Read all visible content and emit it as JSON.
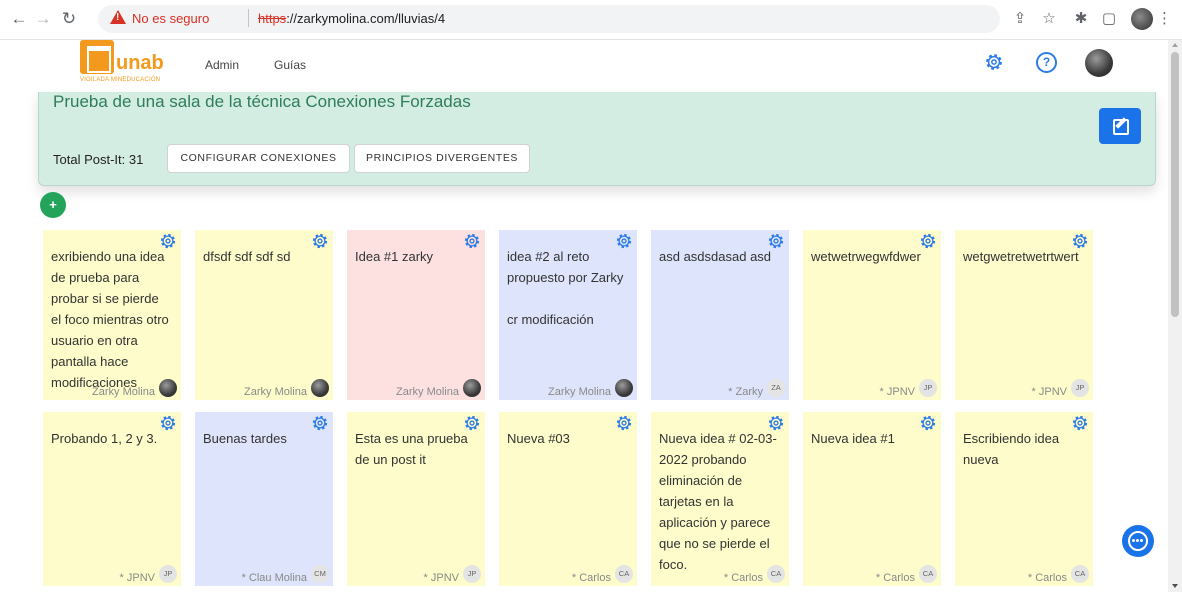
{
  "browser": {
    "insecure_label": "No es seguro",
    "url_scheme": "https",
    "url_rest": "://zarkymolina.com/lluvias/4"
  },
  "navbar": {
    "logo_text": "unab",
    "logo_subtitle": "VIGILADA MINEDUCACIÓN",
    "links": [
      "Admin",
      "Guías"
    ],
    "help_label": "?"
  },
  "room": {
    "title": "Prueba de una sala de la técnica Conexiones Forzadas",
    "total_label": "Total Post-It: 31",
    "buttons": [
      "CONFIGURAR CONEXIONES",
      "PRINCIPIOS DIVERGENTES"
    ]
  },
  "add_label": "+",
  "colors": {
    "yellow": "#fdfcca",
    "pink": "#fde0e0",
    "blue": "#dde4fb",
    "accent": "#1a73e8",
    "green": "#24a35a"
  },
  "posts": [
    {
      "text": "exribiendo una idea de prueba para probar si se pierde el foco mientras otro usuario en otra pantalla hace modificaciones",
      "author": "Zarky Molina",
      "initials": "",
      "color": "yellow"
    },
    {
      "text": "dfsdf sdf sdf sd",
      "author": "Zarky Molina",
      "initials": "",
      "color": "yellow"
    },
    {
      "text": "Idea #1 zarky",
      "author": "Zarky Molina",
      "initials": "",
      "color": "pink"
    },
    {
      "text": "idea #2 al reto propuesto por Zarky\n\ncr modificación",
      "author": "Zarky Molina",
      "initials": "",
      "color": "blue"
    },
    {
      "text": "asd asdsdasad asd",
      "author": "* Zarky",
      "initials": "ZA",
      "color": "blue"
    },
    {
      "text": "wetwetrwegwfdwer",
      "author": "* JPNV",
      "initials": "JP",
      "color": "yellow"
    },
    {
      "text": "wetgwetretwetrtwert",
      "author": "* JPNV",
      "initials": "JP",
      "color": "yellow"
    },
    {
      "text": "Probando 1, 2 y 3.",
      "author": "* JPNV",
      "initials": "JP",
      "color": "yellow"
    },
    {
      "text": "Buenas tardes",
      "author": "* Clau Molina",
      "initials": "CM",
      "color": "blue"
    },
    {
      "text": "Esta es una prueba de un post it",
      "author": "* JPNV",
      "initials": "JP",
      "color": "yellow"
    },
    {
      "text": "Nueva #03",
      "author": "* Carlos",
      "initials": "CA",
      "color": "yellow"
    },
    {
      "text": "Nueva idea # 02-03-2022 probando eliminación de tarjetas en la aplicación y parece que no se pierde el foco.",
      "author": "* Carlos",
      "initials": "CA",
      "color": "yellow"
    },
    {
      "text": "Nueva idea #1",
      "author": "* Carlos",
      "initials": "CA",
      "color": "yellow"
    },
    {
      "text": "Escribiendo idea nueva",
      "author": "* Carlos",
      "initials": "CA",
      "color": "yellow"
    }
  ]
}
